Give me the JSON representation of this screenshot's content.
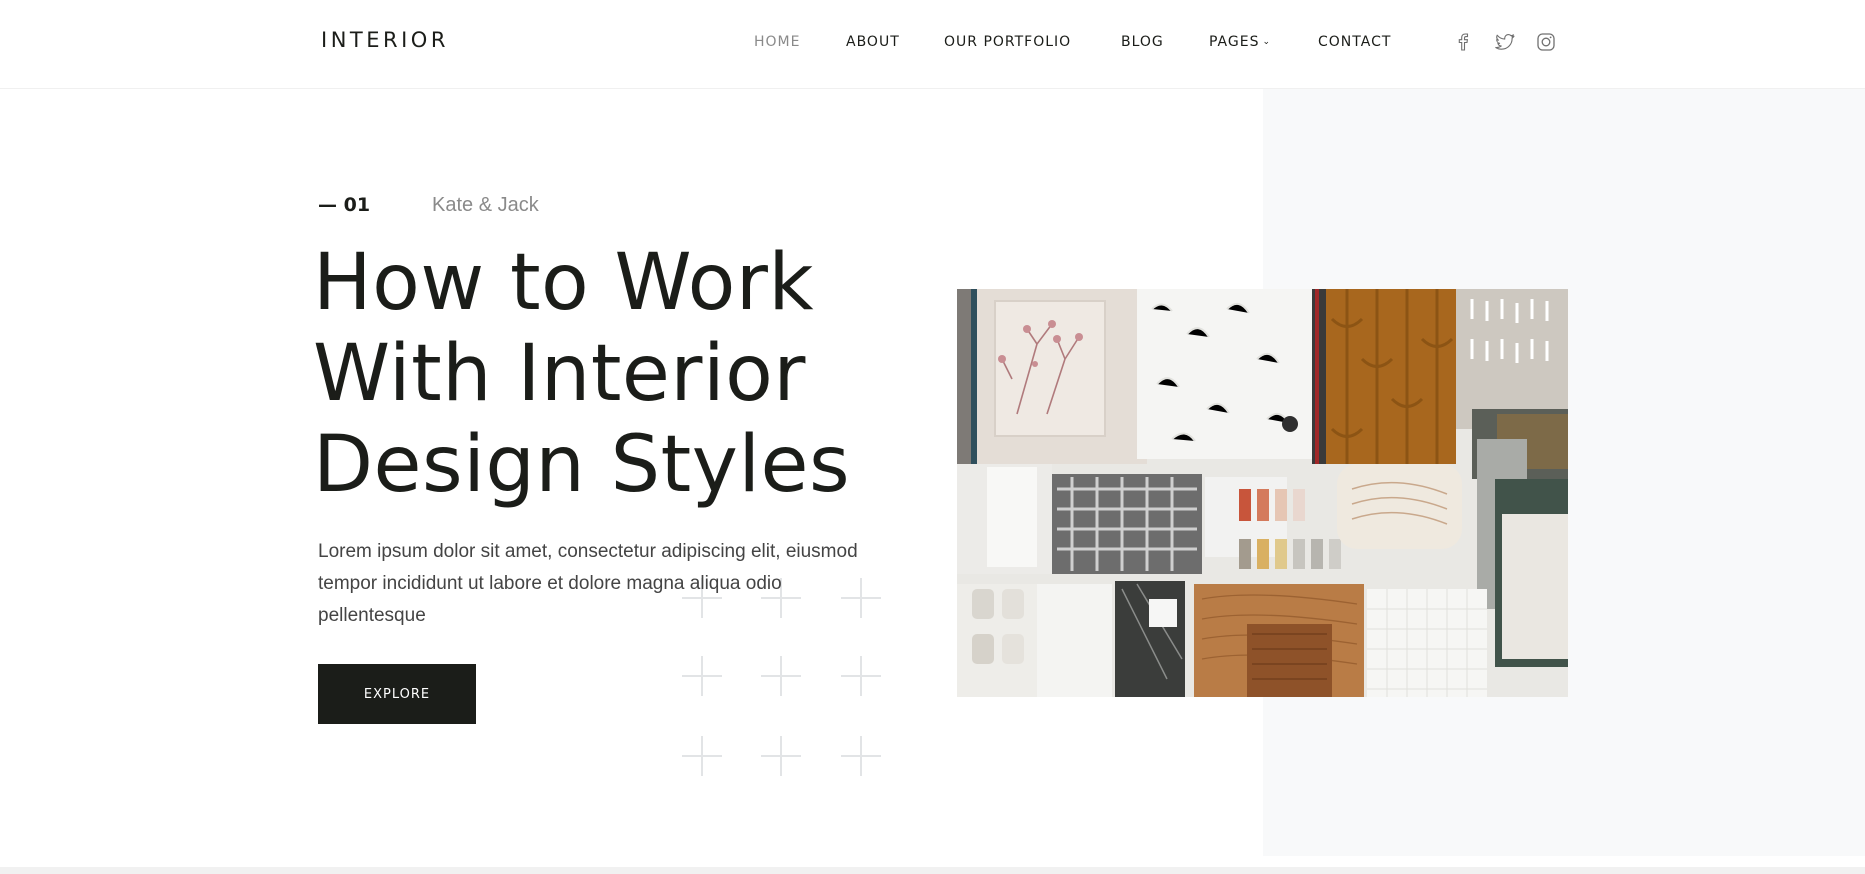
{
  "header": {
    "brand": "INTERIOR",
    "nav": [
      {
        "label": "HOME",
        "active": true
      },
      {
        "label": "ABOUT"
      },
      {
        "label": "OUR PORTFOLIO"
      },
      {
        "label": "BLOG"
      },
      {
        "label": "PAGES",
        "has_dropdown": true
      },
      {
        "label": "CONTACT"
      }
    ],
    "social": [
      "facebook-icon",
      "twitter-icon",
      "instagram-icon"
    ]
  },
  "hero": {
    "slide_number": "— 01",
    "author": "Kate & Jack",
    "headline_lines": [
      "How to Work",
      "With Interior",
      "Design Styles"
    ],
    "lead_lines": [
      "Lorem ipsum dolor sit amet, consectetur adipiscing elit, eiusmod",
      "tempor incididunt ut labore et dolore magna aliqua odio",
      "pellentesque"
    ],
    "cta_label": "EXPLORE"
  },
  "colors": {
    "text_dark": "#1b1d19",
    "muted": "#8a8a8a",
    "panel": "#f8f9fa",
    "button_bg": "#1b1d19",
    "button_text": "#ffffff"
  }
}
